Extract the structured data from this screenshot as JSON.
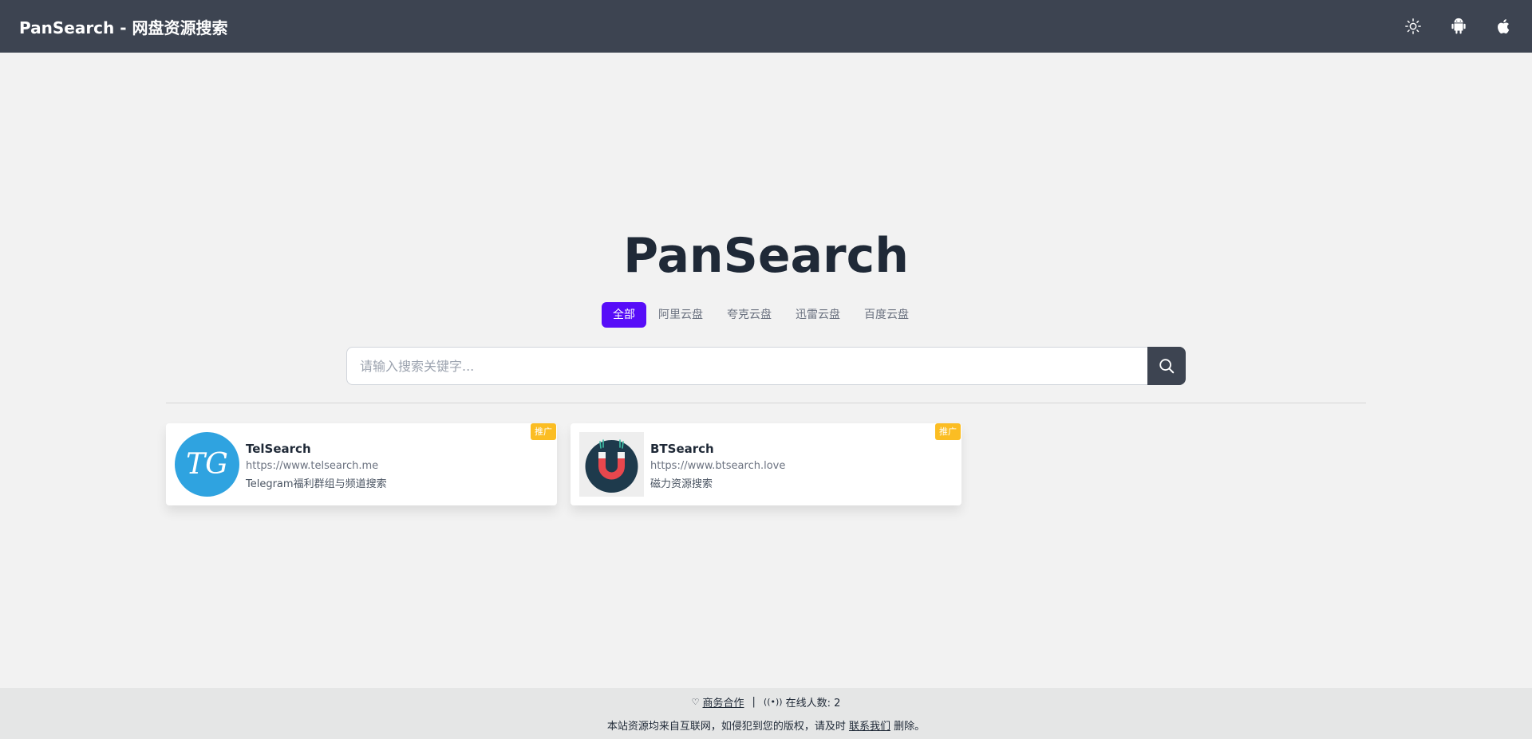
{
  "header": {
    "brand": "PanSearch - 网盘资源搜索",
    "icons": [
      "sun-icon",
      "android-icon",
      "apple-icon"
    ]
  },
  "hero": {
    "title": "PanSearch"
  },
  "tabs": [
    {
      "label": "全部",
      "active": true
    },
    {
      "label": "阿里云盘",
      "active": false
    },
    {
      "label": "夸克云盘",
      "active": false
    },
    {
      "label": "迅雷云盘",
      "active": false
    },
    {
      "label": "百度云盘",
      "active": false
    }
  ],
  "search": {
    "placeholder": "请输入搜索关键字...",
    "value": ""
  },
  "cards": [
    {
      "name": "TelSearch",
      "url": "https://www.telsearch.me",
      "desc": "Telegram福利群组与频道搜索",
      "badge": "推广",
      "logo_text": "TG"
    },
    {
      "name": "BTSearch",
      "url": "https://www.btsearch.love",
      "desc": "磁力资源搜索",
      "badge": "推广"
    }
  ],
  "footer": {
    "business_label": "商务合作",
    "separator": "|",
    "online_label": "在线人数: 2",
    "notice_prefix": "本站资源均来自互联网，如侵犯到您的版权，请及时",
    "contact_label": "联系我们",
    "notice_suffix": "删除。"
  },
  "colors": {
    "navbar": "#3d4451",
    "primary": "#570df8",
    "badge": "#fbbd23",
    "background": "#f2f2f2",
    "footer": "#e5e6e6"
  }
}
